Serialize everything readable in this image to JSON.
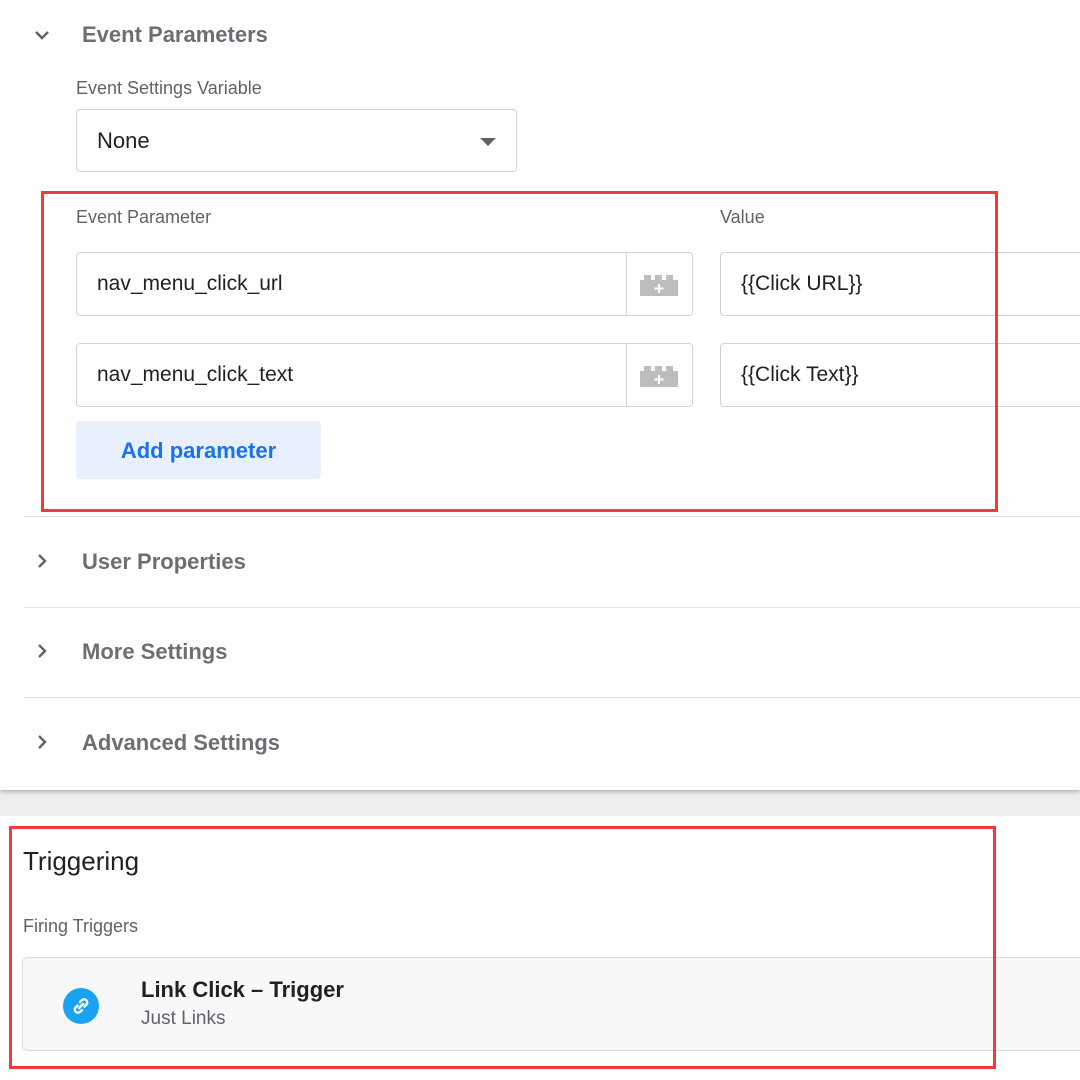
{
  "event_parameters": {
    "section_title": "Event Parameters",
    "settings_variable_label": "Event Settings Variable",
    "settings_variable_value": "None",
    "parameter_header": "Event Parameter",
    "value_header": "Value",
    "rows": [
      {
        "name": "nav_menu_click_url",
        "value": "{{Click URL}}"
      },
      {
        "name": "nav_menu_click_text",
        "value": "{{Click Text}}"
      }
    ],
    "add_button": "Add parameter"
  },
  "collapsed_sections": [
    "User Properties",
    "More Settings",
    "Advanced Settings"
  ],
  "triggering": {
    "title": "Triggering",
    "firing_label": "Firing Triggers",
    "trigger": {
      "name": "Link Click – Trigger",
      "type": "Just Links",
      "icon": "link-icon",
      "icon_color": "#1aa3f0"
    }
  },
  "colors": {
    "highlight": "#ef3b3b",
    "accent": "#1a73e8"
  },
  "icons": {
    "expanded": "chevron-down-icon",
    "collapsed": "chevron-right-icon",
    "variable_picker": "variable-picker-icon"
  }
}
